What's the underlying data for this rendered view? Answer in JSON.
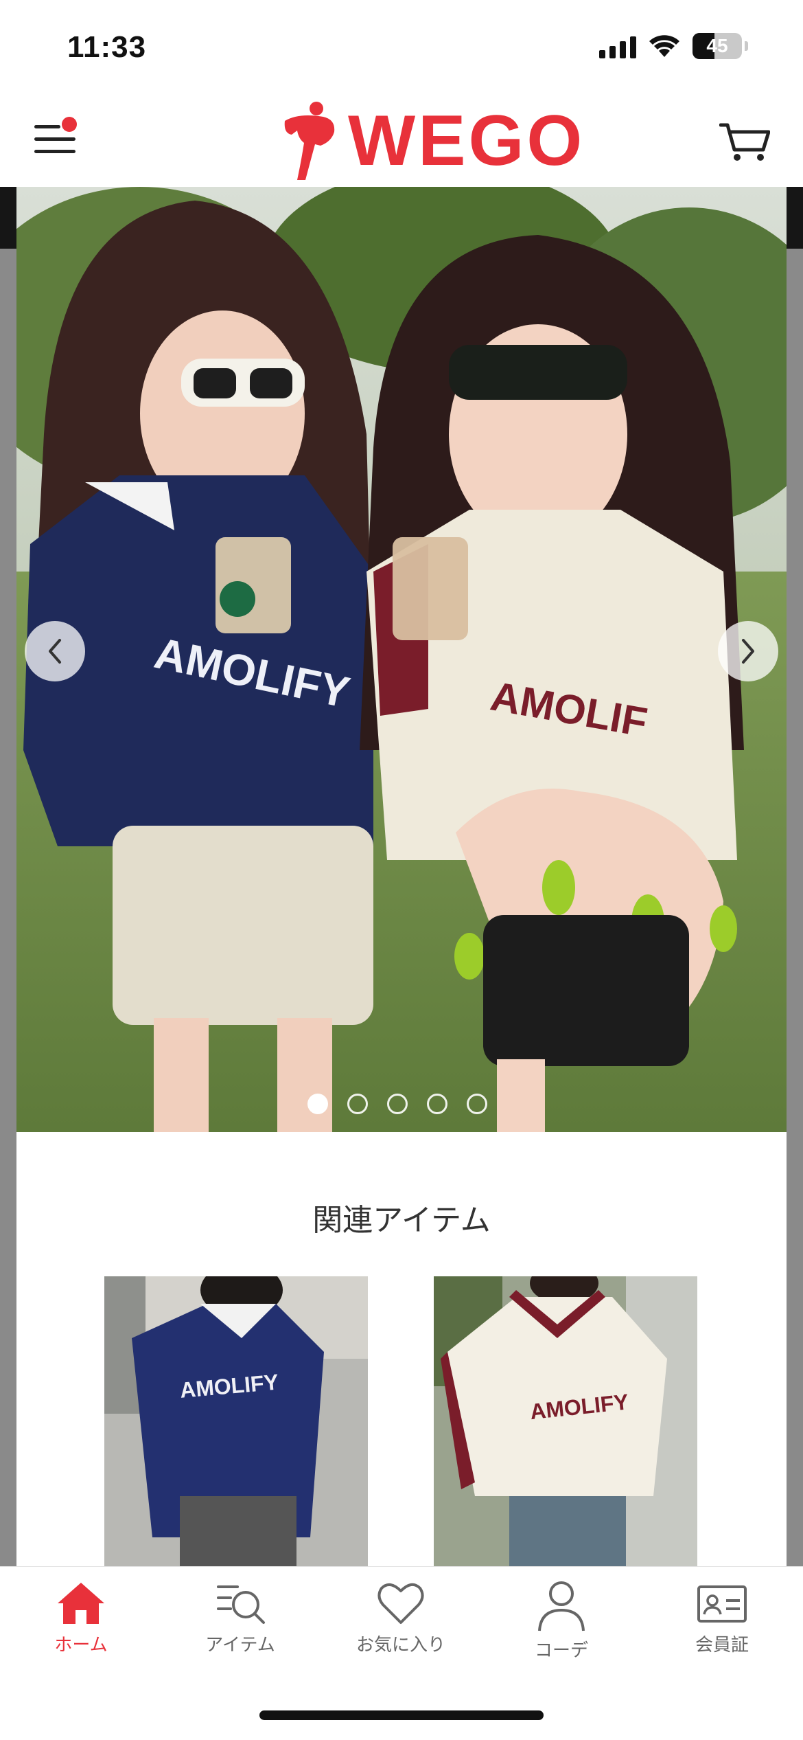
{
  "status_bar": {
    "time": "11:33",
    "battery": "45",
    "battery_level": 0.45
  },
  "header": {
    "logo_text": "WEGO",
    "menu_icon": "hamburger-menu-icon",
    "cart_icon": "cart-icon",
    "brand_color": "#e8313a"
  },
  "carousel": {
    "slide_count": 5,
    "active_index": 0,
    "prev_icon": "chevron-left-icon",
    "next_icon": "chevron-right-icon"
  },
  "related": {
    "title": "関連アイテム",
    "items": [
      {
        "image": "navy AMOLIFY jersey photo"
      },
      {
        "image": "white/maroon AMOLIFY jersey photo"
      }
    ]
  },
  "bottom_nav": {
    "items": [
      {
        "label": "ホーム",
        "icon": "home-icon",
        "active": true
      },
      {
        "label": "アイテム",
        "icon": "item-search-icon",
        "active": false
      },
      {
        "label": "お気に入り",
        "icon": "heart-icon",
        "active": false
      },
      {
        "label": "コーデ",
        "icon": "person-icon",
        "active": false
      },
      {
        "label": "会員証",
        "icon": "member-card-icon",
        "active": false
      }
    ]
  }
}
